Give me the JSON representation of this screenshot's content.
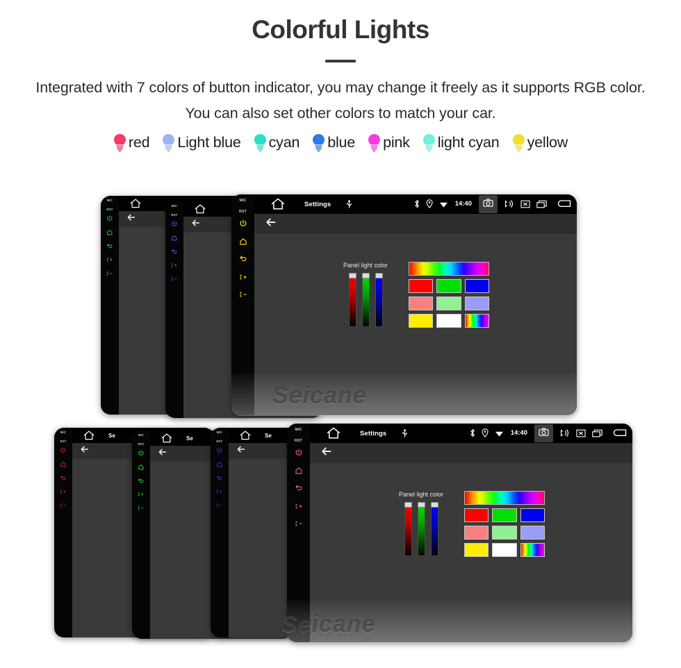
{
  "header": {
    "title": "Colorful Lights",
    "subtitle": "Integrated with 7 colors of button indicator, you may change it freely as it supports RGB color. You can also set other colors to match your car."
  },
  "legend": {
    "items": [
      {
        "label": "red",
        "color": "#f43a68"
      },
      {
        "label": "Light blue",
        "color": "#9db2f7"
      },
      {
        "label": "cyan",
        "color": "#29e0c8"
      },
      {
        "label": "blue",
        "color": "#2e7ae8"
      },
      {
        "label": "pink",
        "color": "#f93ce0"
      },
      {
        "label": "light cyan",
        "color": "#6cf2d8"
      },
      {
        "label": "yellow",
        "color": "#efe02e"
      }
    ]
  },
  "status_bar": {
    "title": "Settings",
    "time": "14:40",
    "title_clipped": "Se",
    "icons": {
      "home": "home-icon",
      "usb": "usb-icon",
      "bluetooth": "bluetooth-icon",
      "location": "location-icon",
      "wifi": "wifi-icon",
      "camera": "camera-icon",
      "volume": "volume-icon",
      "close": "close-box-icon",
      "recents": "recents-icon",
      "back": "back-arrow-icon"
    }
  },
  "hardware_buttons": {
    "mic_label": "MIC",
    "rst_label": "RST",
    "icons": [
      "power-icon",
      "home-icon",
      "back-icon",
      "volume-up-icon",
      "volume-down-icon"
    ]
  },
  "color_picker": {
    "label": "Panel light color",
    "sliders": [
      {
        "name": "red-slider",
        "channel": "R",
        "value": 100
      },
      {
        "name": "green-slider",
        "channel": "G",
        "value": 100
      },
      {
        "name": "blue-slider",
        "channel": "B",
        "value": 100
      }
    ],
    "hue_strip": "hue-gradient-strip",
    "swatches": [
      [
        "#ff0000",
        "#00e000",
        "#0000ee"
      ],
      [
        "#f98080",
        "#93ef93",
        "#9a9cf7"
      ],
      [
        "#ffee00",
        "#ffffff",
        "rainbow"
      ]
    ]
  },
  "watermark": {
    "text": "Seicane"
  },
  "groups": {
    "top": {
      "units": [
        {
          "name": "unit-green",
          "accent": "#21cc3a"
        },
        {
          "name": "unit-violet",
          "accent": "#5a52e8"
        },
        {
          "name": "unit-yellow",
          "accent": "#ffd400"
        }
      ]
    },
    "bottom": {
      "units": [
        {
          "name": "unit-red",
          "accent": "#e81c1c"
        },
        {
          "name": "unit-green",
          "accent": "#21cc3a"
        },
        {
          "name": "unit-blue",
          "accent": "#1f3cf0"
        },
        {
          "name": "unit-pink",
          "accent": "#e65a6a"
        }
      ]
    }
  }
}
